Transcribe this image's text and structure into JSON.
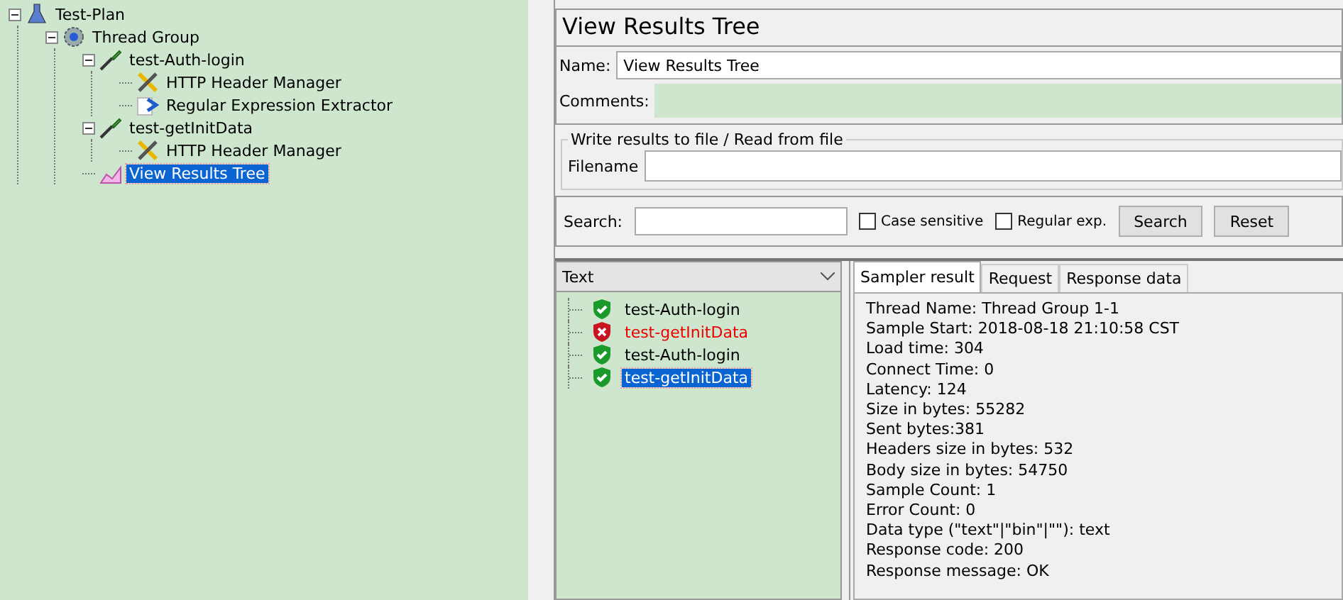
{
  "test_tree": [
    {
      "label": "Test-Plan",
      "kind": "plan",
      "expanded": true,
      "selected": false,
      "children": [
        {
          "label": "Thread Group",
          "kind": "thread-group",
          "expanded": true,
          "selected": false,
          "children": [
            {
              "label": "test-Auth-login",
              "kind": "sampler",
              "expanded": true,
              "selected": false,
              "children": [
                {
                  "label": "HTTP Header Manager",
                  "kind": "config",
                  "selected": false
                },
                {
                  "label": "Regular Expression Extractor",
                  "kind": "extractor",
                  "selected": false
                }
              ]
            },
            {
              "label": "test-getInitData",
              "kind": "sampler",
              "expanded": true,
              "selected": false,
              "children": [
                {
                  "label": "HTTP Header Manager",
                  "kind": "config",
                  "selected": false
                }
              ]
            },
            {
              "label": "View Results Tree",
              "kind": "listener",
              "selected": true
            }
          ]
        }
      ]
    }
  ],
  "panel": {
    "title": "View Results Tree",
    "name_label": "Name:",
    "name_value": "View Results Tree",
    "comments_label": "Comments:",
    "file_group": {
      "legend": "Write results to file / Read from file",
      "filename_label": "Filename"
    },
    "search": {
      "label": "Search:",
      "case_sensitive": {
        "label": "Case sensitive",
        "checked": false
      },
      "regular_exp": {
        "label": "Regular exp.",
        "checked": false
      },
      "buttons": [
        "Search",
        "Reset"
      ]
    },
    "renderer": "Text",
    "results": [
      {
        "label": "test-Auth-login",
        "kind": "success",
        "selected": false
      },
      {
        "label": "test-getInitData",
        "kind": "error",
        "selected": false
      },
      {
        "label": "test-Auth-login",
        "kind": "success",
        "selected": false
      },
      {
        "label": "test-getInitData",
        "kind": "success",
        "selected": true
      }
    ],
    "tabs": [
      {
        "label": "Sampler result",
        "selected": true
      },
      {
        "label": "Request",
        "selected": false
      },
      {
        "label": "Response data",
        "selected": false
      }
    ],
    "sampler_result": [
      "Thread Name: Thread Group 1-1",
      "Sample Start: 2018-08-18 21:10:58 CST",
      "Load time: 304",
      "Connect Time: 0",
      "Latency: 124",
      "Size in bytes: 55282",
      "Sent bytes:381",
      "Headers size in bytes: 532",
      "Body size in bytes: 54750",
      "Sample Count: 1",
      "Error Count: 0",
      "Data type (\"text\"|\"bin\"|\"\"): text",
      "Response code: 200",
      "Response message: OK"
    ]
  }
}
